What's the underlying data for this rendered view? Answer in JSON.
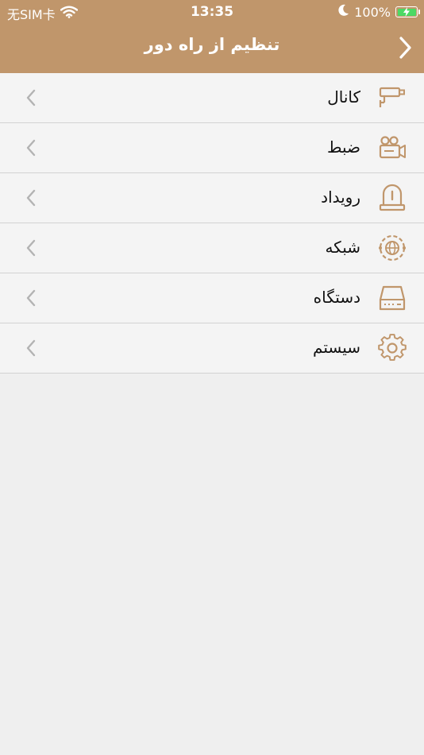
{
  "status_bar": {
    "carrier": "无SIM卡",
    "time": "13:35",
    "battery_percent": "100%",
    "battery_level": 1.0
  },
  "nav": {
    "title": "تنظیم از راه دور",
    "back_icon": "chevron-right-icon"
  },
  "menu": [
    {
      "label": "کانال",
      "icon": "surveillance-camera-icon"
    },
    {
      "label": "ضبط",
      "icon": "video-camera-icon"
    },
    {
      "label": "رویداد",
      "icon": "alarm-beacon-icon"
    },
    {
      "label": "شبکه",
      "icon": "network-globe-icon"
    },
    {
      "label": "دستگاه",
      "icon": "device-recorder-icon"
    },
    {
      "label": "سیستم",
      "icon": "gear-icon"
    }
  ],
  "colors": {
    "header_bg": "#c0966b",
    "icon_accent": "#c0966b",
    "row_bg": "#f4f4f4",
    "page_bg": "#efefef",
    "chevron": "#b3b3b3"
  }
}
